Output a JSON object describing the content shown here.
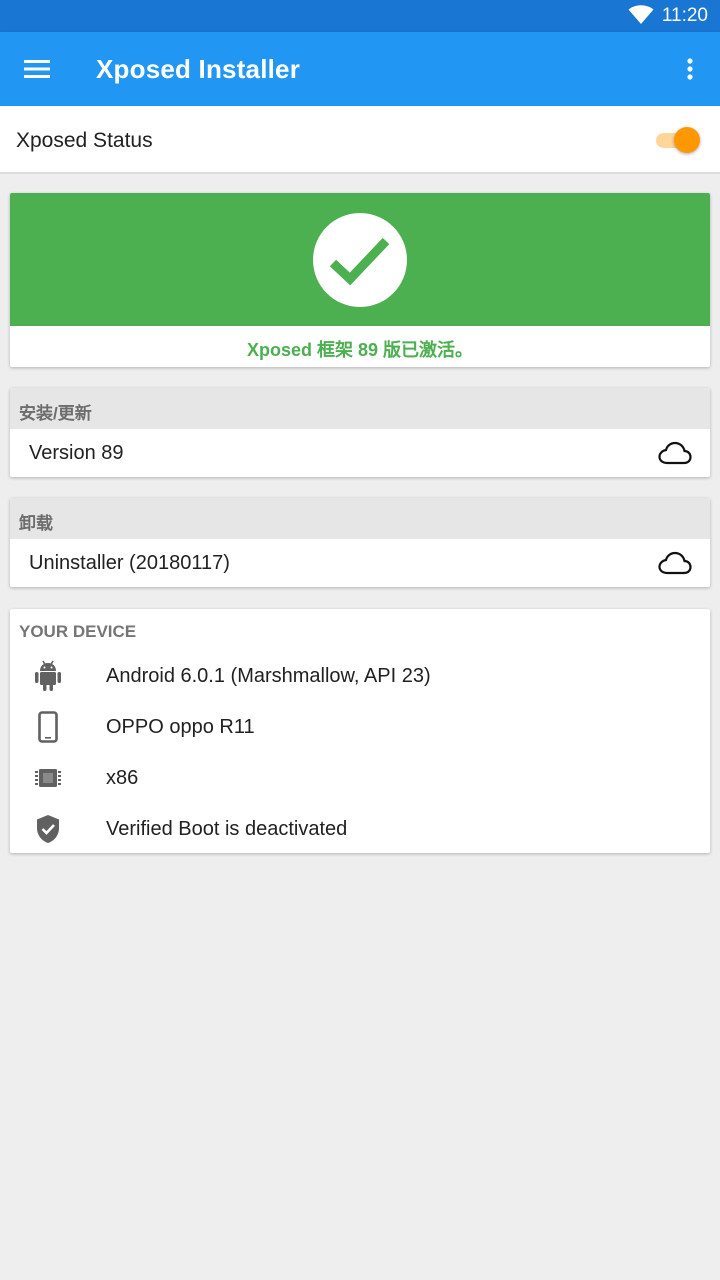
{
  "status_bar": {
    "time": "11:20",
    "wifi_icon": "wifi-icon"
  },
  "app_bar": {
    "title": "Xposed Installer",
    "menu_icon": "hamburger-menu-icon",
    "more_icon": "more-vert-icon"
  },
  "xposed_status": {
    "label": "Xposed Status",
    "enabled": true,
    "accent": "#ff9800"
  },
  "framework": {
    "message": "Xposed 框架 89 版已激活。",
    "color": "#4caf50",
    "icon": "check-icon"
  },
  "install": {
    "header": "安装/更新",
    "item": "Version 89",
    "icon": "cloud-icon"
  },
  "uninstall": {
    "header": "卸载",
    "item": "Uninstaller (20180117)",
    "icon": "cloud-icon"
  },
  "device": {
    "header": "YOUR DEVICE",
    "items": [
      {
        "icon": "android-icon",
        "text": "Android 6.0.1 (Marshmallow, API 23)"
      },
      {
        "icon": "phone-icon",
        "text": "OPPO oppo R11"
      },
      {
        "icon": "chip-icon",
        "text": "x86"
      },
      {
        "icon": "shield-check-icon",
        "text": "Verified Boot is deactivated"
      }
    ]
  },
  "colors": {
    "primary": "#2196f3",
    "primary_dark": "#1976d2",
    "background": "#eeeeee"
  }
}
